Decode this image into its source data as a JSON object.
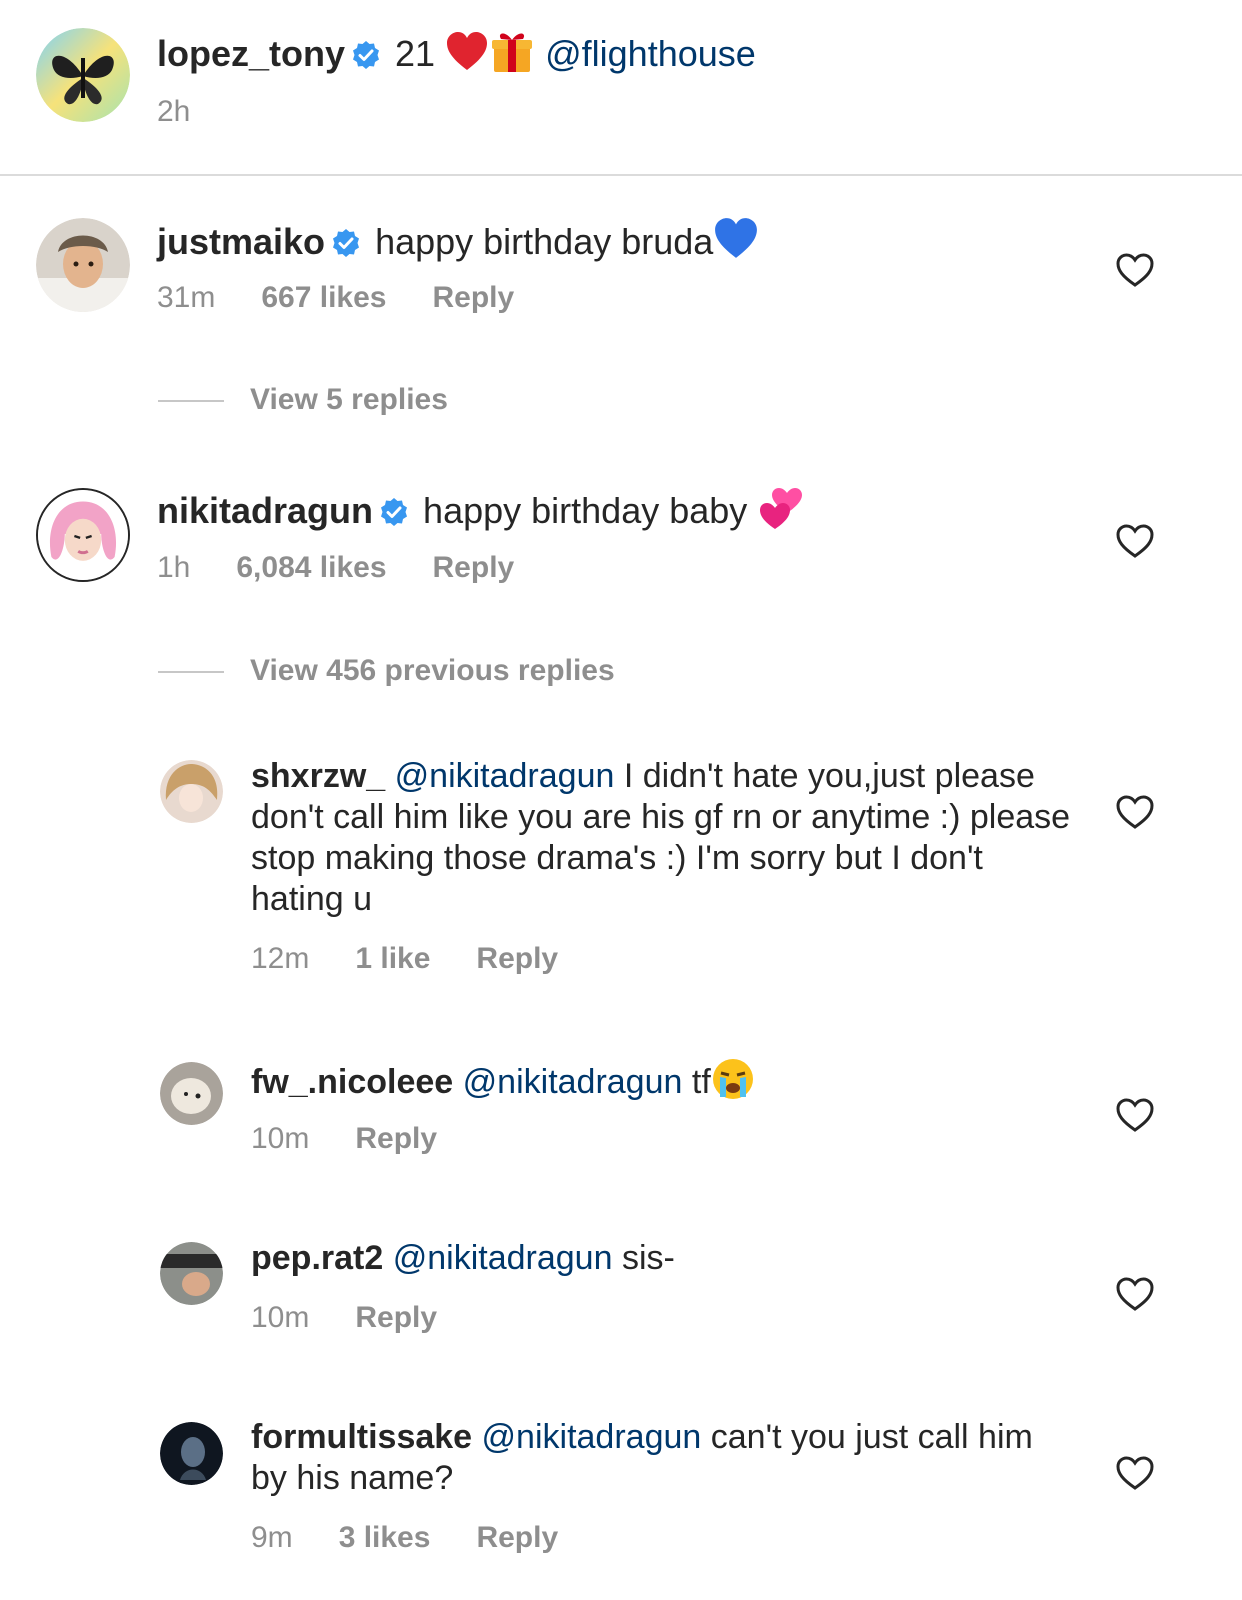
{
  "caption": {
    "username": "lopez_tony",
    "text": "21",
    "mention": "@flighthouse",
    "time": "2h"
  },
  "comments": [
    {
      "username": "justmaiko",
      "text": "happy birthday bruda",
      "time": "31m",
      "likes": "667 likes",
      "reply": "Reply",
      "view_replies": "View 5 replies"
    },
    {
      "username": "nikitadragun",
      "text": "happy birthday baby",
      "time": "1h",
      "likes": "6,084 likes",
      "reply": "Reply",
      "view_replies": "View 456 previous replies"
    }
  ],
  "replies": [
    {
      "username": "shxrzw_",
      "mention": "@nikitadragun",
      "text": "I didn't hate you,just please don't call him like you are his gf rn or anytime :) please stop making those drama's :) I'm sorry but I don't hating u",
      "time": "12m",
      "likes": "1 like",
      "reply": "Reply"
    },
    {
      "username": "fw_.nicoleee",
      "mention": "@nikitadragun",
      "text": "tf",
      "time": "10m",
      "reply": "Reply"
    },
    {
      "username": "pep.rat2",
      "mention": "@nikitadragun",
      "text": "sis-",
      "time": "10m",
      "reply": "Reply"
    },
    {
      "username": "formultissake",
      "mention": "@nikitadragun",
      "text": "can't you just call him by his name?",
      "time": "9m",
      "likes": "3 likes",
      "reply": "Reply"
    }
  ],
  "icons": {
    "verified": "verified-badge-icon",
    "like": "heart-outline-icon"
  },
  "colors": {
    "text": "#262626",
    "secondary": "#8e8e8e",
    "mention": "#00376b",
    "verified": "#3897f0",
    "divider": "#dbdbdb"
  }
}
